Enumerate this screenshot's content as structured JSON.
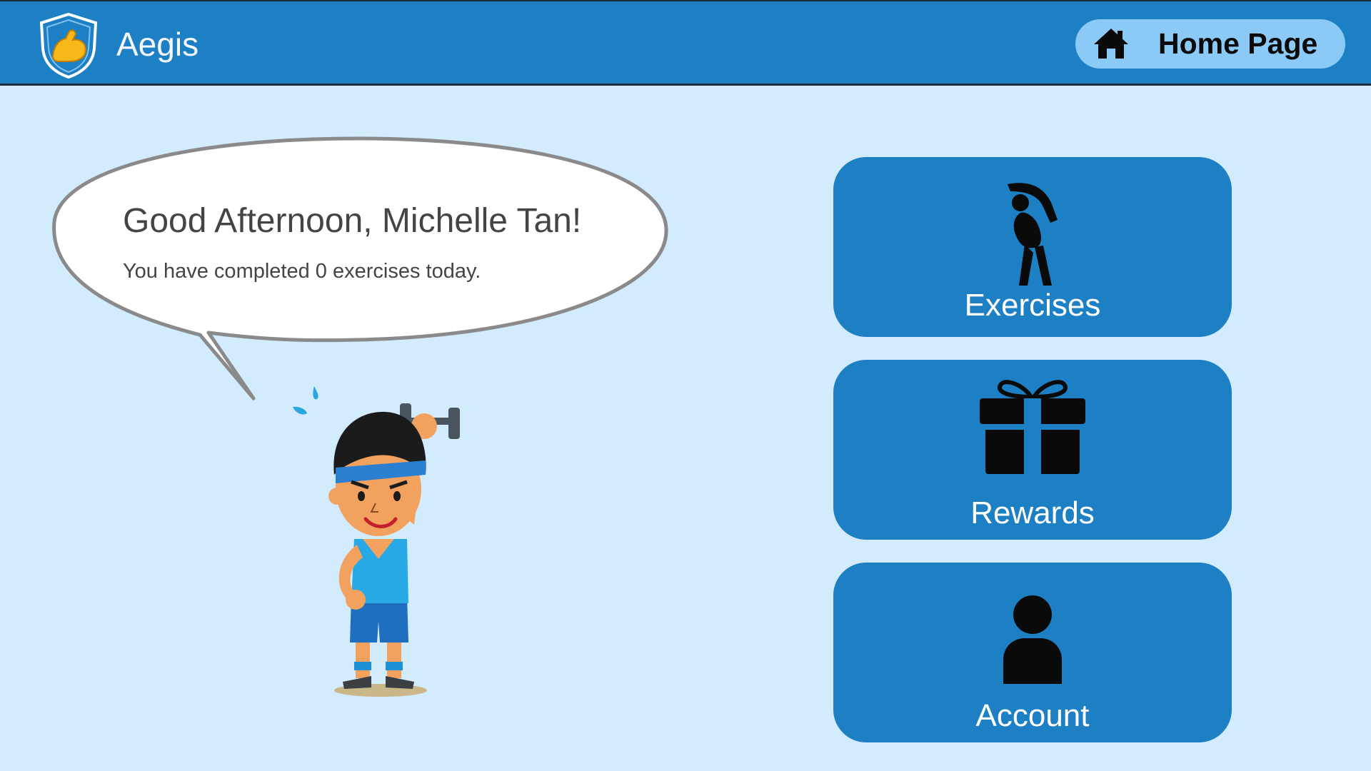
{
  "header": {
    "app_name": "Aegis",
    "logo_icon": "shield-flexed-biceps-icon",
    "home_button_label": "Home Page",
    "home_icon": "home-icon"
  },
  "greeting": {
    "title": "Good Afternoon, Michelle Tan!",
    "message": "You have completed 0 exercises today."
  },
  "menu": [
    {
      "label": "Exercises",
      "icon": "stretching-person-icon"
    },
    {
      "label": "Rewards",
      "icon": "gift-icon"
    },
    {
      "label": "Account",
      "icon": "user-icon"
    }
  ],
  "colors": {
    "header_bg": "#1e80c4",
    "page_bg": "#d2ebfd",
    "card_bg": "#1e80c4",
    "home_button_bg": "#8bc9f6"
  }
}
